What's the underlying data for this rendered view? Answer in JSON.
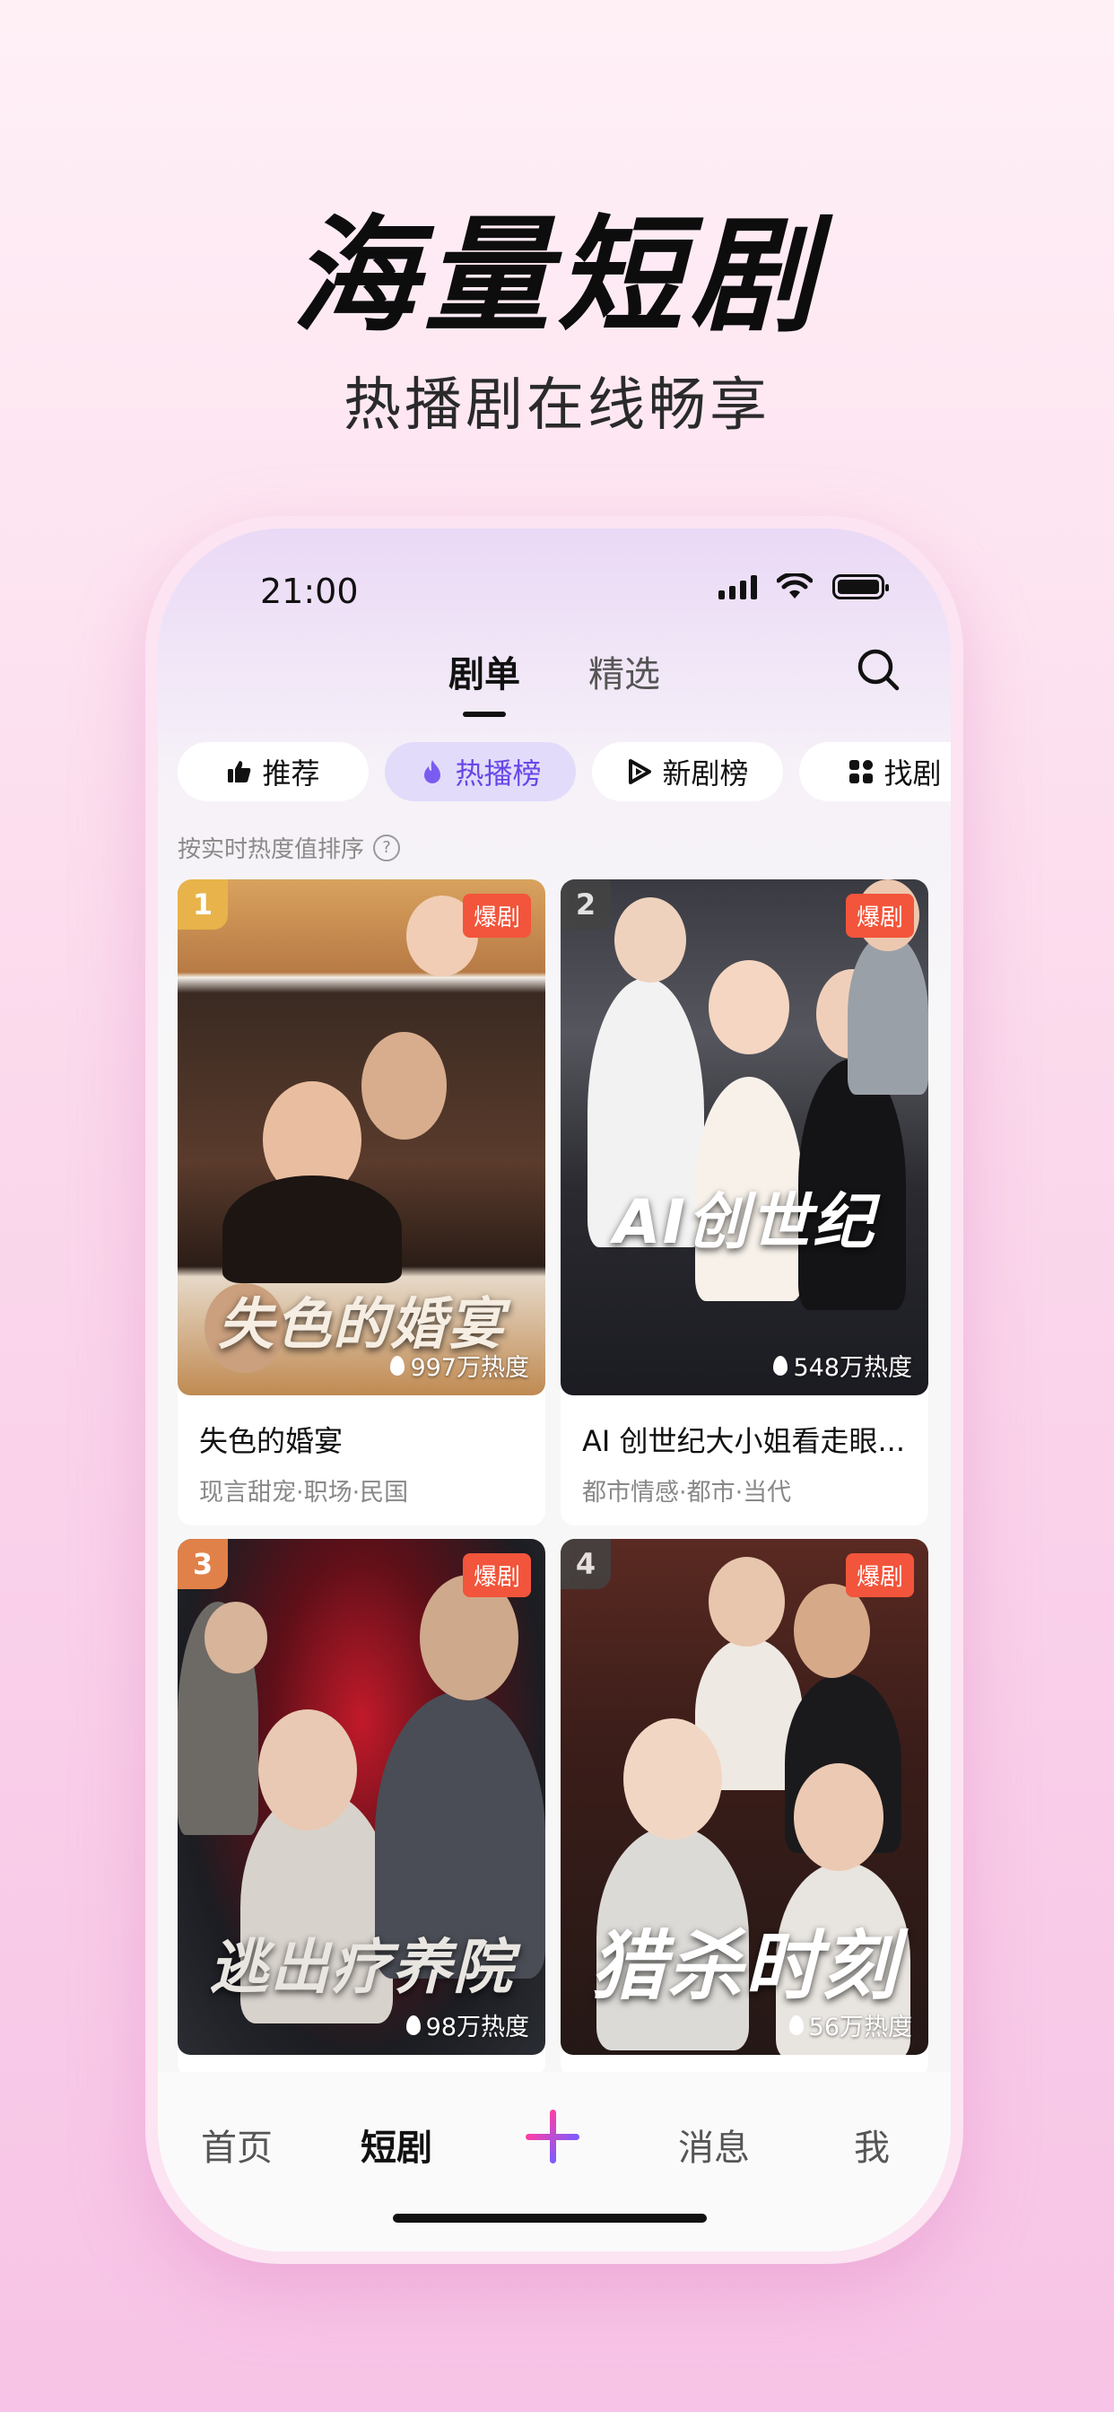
{
  "promo": {
    "headline": "海量短剧",
    "subline": "热播剧在线畅享"
  },
  "status_bar": {
    "time": "21:00"
  },
  "top_tabs": [
    {
      "label": "剧单",
      "active": true
    },
    {
      "label": "精选",
      "active": false
    }
  ],
  "chips": [
    {
      "label": "推荐",
      "icon": "thumbs-up-icon",
      "active": false
    },
    {
      "label": "热播榜",
      "icon": "flame-icon",
      "active": true
    },
    {
      "label": "新剧榜",
      "icon": "play-icon",
      "active": false
    },
    {
      "label": "找剧",
      "icon": "grid-icon",
      "active": false
    }
  ],
  "sort_hint": "按实时热度值排序",
  "cards": [
    {
      "rank": "1",
      "badge": "爆剧",
      "heat": "997万热度",
      "poster_text": "失色的婚宴",
      "title": "失色的婚宴",
      "tags": "现言甜宠·职场·民国"
    },
    {
      "rank": "2",
      "badge": "爆剧",
      "heat": "548万热度",
      "poster_text": "AI创世纪",
      "title": "AI 创世纪大小姐看走眼...",
      "tags": "都市情感·都市·当代"
    },
    {
      "rank": "3",
      "badge": "爆剧",
      "heat": "98万热度",
      "poster_text": "逃出疗养院",
      "title": "",
      "tags": ""
    },
    {
      "rank": "4",
      "badge": "爆剧",
      "heat": "56万热度",
      "poster_text": "猎杀时刻",
      "title": "",
      "tags": ""
    }
  ],
  "bottom_nav": [
    {
      "label": "首页",
      "active": false
    },
    {
      "label": "短剧",
      "active": true
    },
    {
      "label": "消息",
      "active": false
    },
    {
      "label": "我",
      "active": false
    }
  ],
  "colors": {
    "accent_purple": "#6847e8",
    "badge_red": "#f2553b",
    "chip_active_bg": "#e2dcfa"
  }
}
